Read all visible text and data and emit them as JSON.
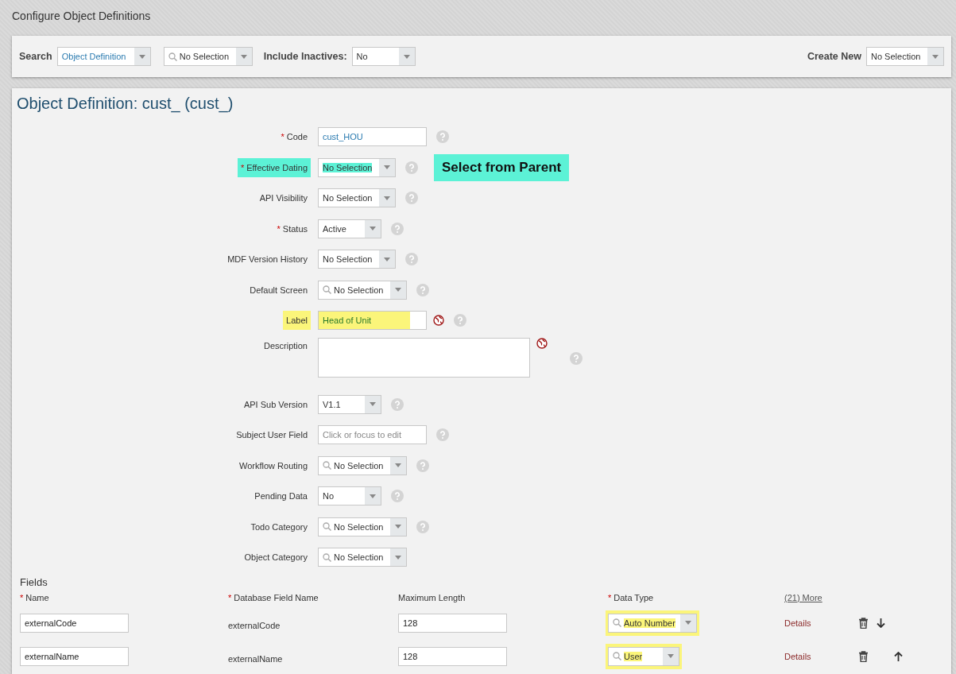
{
  "page_title": "Configure Object Definitions",
  "search_bar": {
    "search_label": "Search",
    "object_type": "Object Definition",
    "object": "No Selection",
    "inactives_label": "Include Inactives:",
    "inactives": "No",
    "create_label": "Create New",
    "create": "No Selection"
  },
  "definition": {
    "title": "Object Definition: cust_ (cust_)",
    "rows": [
      {
        "label": "Code",
        "required_mark": "*",
        "kind": "text",
        "value": "cust_HOU",
        "help": true,
        "translatable": false
      },
      {
        "label": "Effective Dating",
        "required_mark": "*",
        "kind": "select",
        "value": "No Selection",
        "help": true,
        "translatable": false,
        "color": "#5cf2d6",
        "note": "Select from Parent"
      },
      {
        "label": "API Visibility",
        "kind": "select",
        "value": "No Selection",
        "help": true,
        "translatable": false
      },
      {
        "label": "Status",
        "required_mark": "*",
        "kind": "short-select",
        "value": "Active",
        "help": true,
        "translatable": false
      },
      {
        "label": "MDF Version History",
        "kind": "select",
        "value": "No Selection",
        "help": true,
        "translatable": false
      },
      {
        "label": "Default Screen",
        "kind": "search-select",
        "value": "No Selection",
        "help": true,
        "translatable": false
      },
      {
        "label": "Label",
        "kind": "text",
        "value": "Head of Unit",
        "help": true,
        "translatable": true,
        "color": "#fbf57a"
      },
      {
        "label": "Description",
        "kind": "textarea",
        "help": true,
        "translatable": true
      },
      {
        "label": "API Sub Version",
        "kind": "short-select",
        "value": "V1.1",
        "help": true,
        "translatable": false
      },
      {
        "label": "Subject User Field",
        "kind": "text",
        "placeholder": "Click or focus to edit",
        "help": true,
        "translatable": false
      },
      {
        "label": "Workflow Routing",
        "kind": "search-select",
        "value": "No Selection",
        "help": true,
        "translatable": false
      },
      {
        "label": "Pending Data",
        "kind": "short-select",
        "value": "No",
        "help": true,
        "translatable": false
      },
      {
        "label": "Todo Category",
        "kind": "search-select",
        "value": "No Selection",
        "help": true,
        "translatable": false
      },
      {
        "label": "Object Category",
        "kind": "search-select",
        "value": "No Selection",
        "help": false,
        "translatable": false
      }
    ]
  },
  "fields": {
    "title": "Fields",
    "columns": [
      {
        "label": "Name",
        "required_mark": "*"
      },
      {
        "label": "Database Field Name",
        "required_mark": "*"
      },
      {
        "label": "Maximum Length"
      },
      {
        "label": "Data Type",
        "required_mark": "*"
      }
    ],
    "more_link": "(21) More",
    "rows": [
      {
        "name": "externalCode",
        "db_name": "externalCode",
        "max_length": "128",
        "data_type": "Auto Number",
        "color": "#fbf57a",
        "details": "Details",
        "kind": "move-down"
      },
      {
        "name": "externalName",
        "db_name": "externalName",
        "max_length": "128",
        "data_type": "User",
        "color": "#fbf57a",
        "details": "Details",
        "kind": "move-up"
      }
    ]
  }
}
